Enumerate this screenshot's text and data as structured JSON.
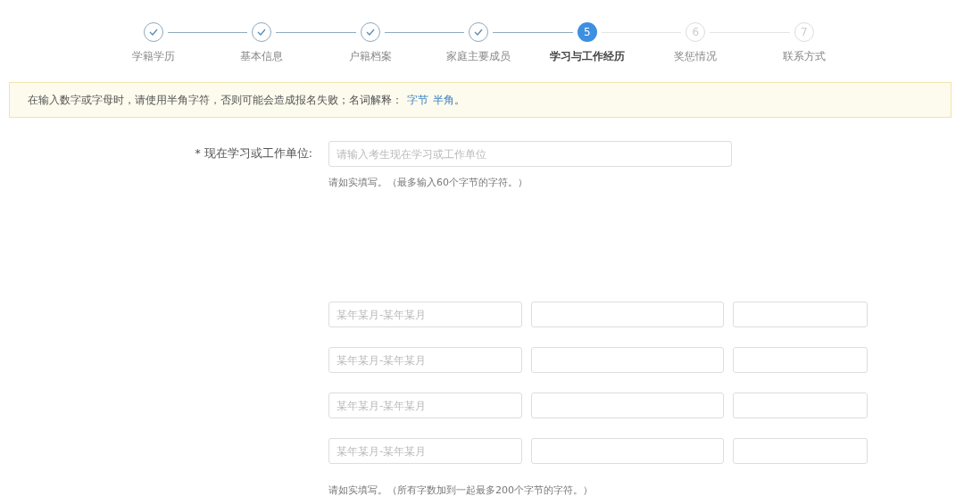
{
  "steps": [
    {
      "label": "学籍学历",
      "kind": "done"
    },
    {
      "label": "基本信息",
      "kind": "done"
    },
    {
      "label": "户籍档案",
      "kind": "done"
    },
    {
      "label": "家庭主要成员",
      "kind": "done"
    },
    {
      "number": "5",
      "label": "学习与工作经历",
      "kind": "current"
    },
    {
      "number": "6",
      "label": "奖惩情况",
      "kind": "pending"
    },
    {
      "number": "7",
      "label": "联系方式",
      "kind": "pending"
    }
  ],
  "notice": {
    "text": "在输入数字或字母时，请使用半角字符，否则可能会造成报名失败；名词解释：",
    "links": [
      "字节",
      "半角"
    ],
    "end": "。"
  },
  "unit_field": {
    "label": "* 现在学习或工作单位:",
    "placeholder": "请输入考生现在学习或工作单位",
    "hint": "请如实填写。（最多输入60个字节的字符。）"
  },
  "history_rows": [
    {
      "period_placeholder": "某年某月-某年某月"
    },
    {
      "period_placeholder": "某年某月-某年某月"
    },
    {
      "period_placeholder": "某年某月-某年某月"
    },
    {
      "period_placeholder": "某年某月-某年某月"
    }
  ],
  "history_hint": "请如实填写。（所有字数加到一起最多200个字节的字符。）"
}
